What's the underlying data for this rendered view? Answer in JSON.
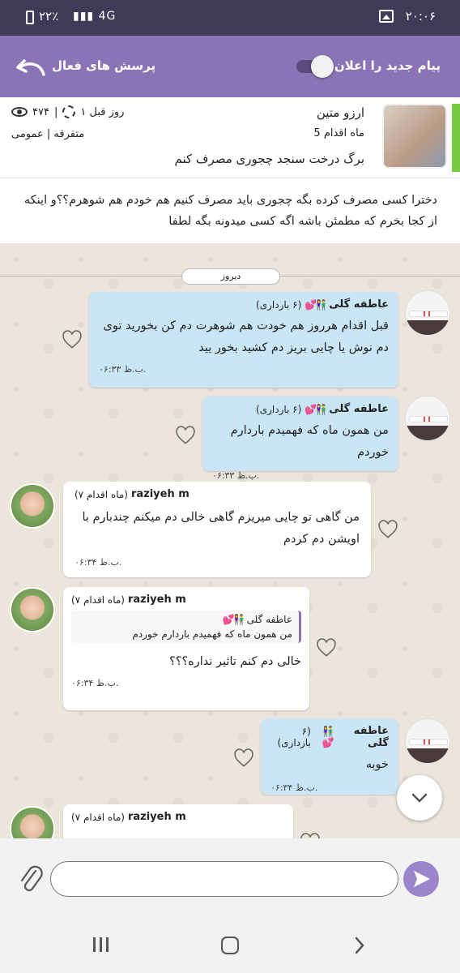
{
  "status_bar": {
    "time": "۲۰:۰۶",
    "battery": "۲۲٪",
    "network": "4G"
  },
  "toolbar": {
    "new_message_label": "پیام جدید را اعلان کن",
    "active_questions_label": "پرسش های فعال"
  },
  "question": {
    "author": "ارزو متین",
    "stage": "5 ماه اقدام",
    "title": "برگ درخت سنجد چجوری مصرف کنم",
    "time_ago": "۱ روز قبل",
    "views": "۴۷۴",
    "meta_sep": "|",
    "category": "متفرقه | عمومی",
    "body": "دخترا کسی مصرف کرده بگه چجوری باید مصرف کنیم هم خودم هم شوهرم؟؟و اینکه از کجا بخرم که مطمئن باشه اگه کسی میدونه بگه لطفا"
  },
  "chat": {
    "day_label": "دیروز",
    "messages": [
      {
        "sender": "عاطفه گلی",
        "emoji": "👫💕",
        "status": "(۶ بارداری)",
        "text": "قبل اقدام هرروز هم خودت هم شوهرت دم کن  بخورید توی دم نوش یا چایی بریز دم کشید بخور یید",
        "time": "۰۶:۳۳ ب.ظ."
      },
      {
        "sender": "عاطفه گلی",
        "emoji": "👫💕",
        "status": "(۶ بارداری)",
        "text": "من همون ماه که فهمیدم باردارم خوردم",
        "time": "۰۶:۳۳ ب.ظ."
      },
      {
        "sender": "raziyeh m",
        "status": "(۷ ماه اقدام)",
        "text": "من گاهی تو چایی میریزم گاهی خالی دم میکنم چندبارم با اویشن دم کردم",
        "time": "۰۶:۳۴ ب.ظ."
      },
      {
        "sender": "raziyeh m",
        "status": "(۷ ماه اقدام)",
        "quote_sender": "عاطفه گلی",
        "quote_emoji": "👫💕",
        "quote_text": "من همون ماه که فهمیدم باردارم خوردم",
        "text": "خالی دم کنم تاثیر نداره؟؟؟",
        "time": "۰۶:۳۴ ب.ظ."
      },
      {
        "sender": "عاطفه گلی",
        "emoji": "👫💕",
        "status": "(۶ بارداری)",
        "text": "خوبه",
        "time": "۰۶:۳۴ ب.ظ."
      },
      {
        "sender": "raziyeh m",
        "status": "(۷ ماه اقدام)"
      }
    ]
  },
  "input": {
    "placeholder": ""
  },
  "colors": {
    "toolbar": "#8b74b5",
    "status_bar": "#3f3b56",
    "outgoing_bubble": "#c8e6f5",
    "chat_bg": "#ece5dc",
    "accent_bar": "#7ac943"
  }
}
